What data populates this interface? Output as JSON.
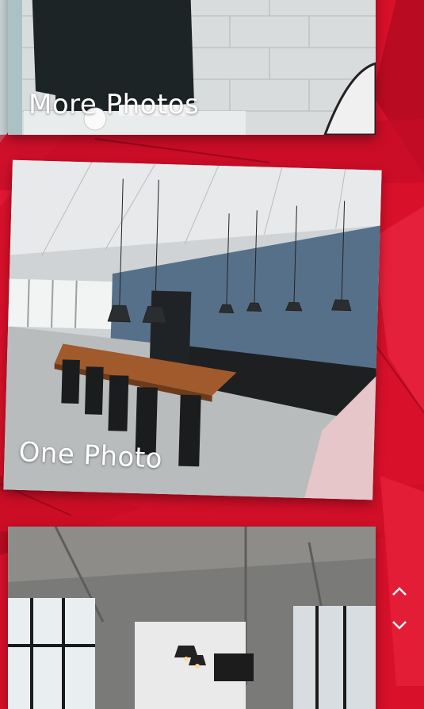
{
  "slides": [
    {
      "caption": "More Photos"
    },
    {
      "caption": "One Photo"
    }
  ],
  "nav": {
    "up_icon": "chevron-up-icon",
    "down_icon": "chevron-down-icon"
  },
  "colors": {
    "background": "#d8102a",
    "accent": "#ffffff",
    "wall_blue": "#56708a"
  }
}
